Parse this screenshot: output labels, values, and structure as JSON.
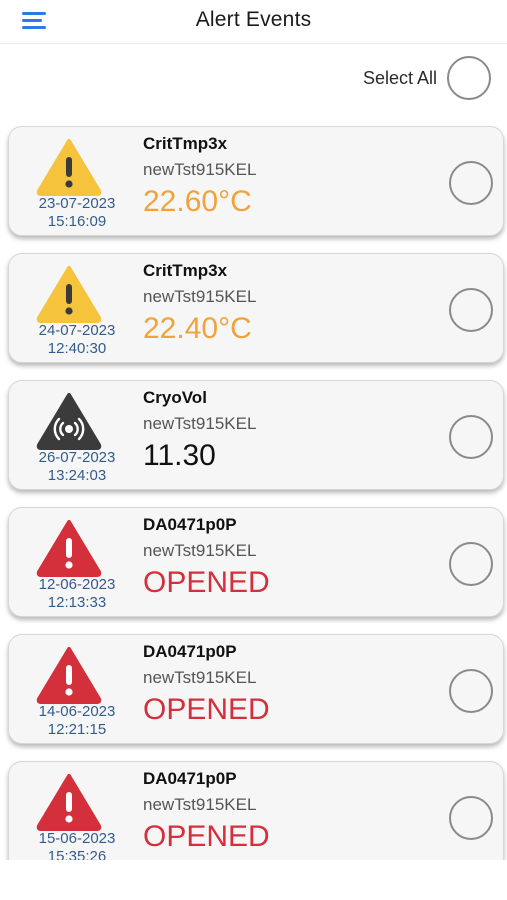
{
  "header": {
    "title": "Alert Events"
  },
  "select_all": {
    "label": "Select All"
  },
  "colors": {
    "accent": "#2c7be5",
    "warning": "#f5c43c",
    "critical": "#d3303b",
    "neutral": "#3b3b3b",
    "date": "#335c8c"
  },
  "alerts": [
    {
      "icon": "warning-triangle-icon",
      "name": "CritTmp3x",
      "device": "newTst915KEL",
      "value": "22.60°C",
      "date": "23-07-2023",
      "time": "15:16:09"
    },
    {
      "icon": "warning-triangle-icon",
      "name": "CritTmp3x",
      "device": "newTst915KEL",
      "value": "22.40°C",
      "date": "24-07-2023",
      "time": "12:40:30"
    },
    {
      "icon": "signal-triangle-icon",
      "name": "CryoVol",
      "device": "newTst915KEL",
      "value": "11.30",
      "date": "26-07-2023",
      "time": "13:24:03"
    },
    {
      "icon": "critical-triangle-icon",
      "name": "DA0471p0P",
      "device": "newTst915KEL",
      "value": "OPENED",
      "date": "12-06-2023",
      "time": "12:13:33"
    },
    {
      "icon": "critical-triangle-icon",
      "name": "DA0471p0P",
      "device": "newTst915KEL",
      "value": "OPENED",
      "date": "14-06-2023",
      "time": "12:21:15"
    },
    {
      "icon": "critical-triangle-icon",
      "name": "DA0471p0P",
      "device": "newTst915KEL",
      "value": "OPENED",
      "date": "15-06-2023",
      "time": "15:35:26"
    }
  ]
}
